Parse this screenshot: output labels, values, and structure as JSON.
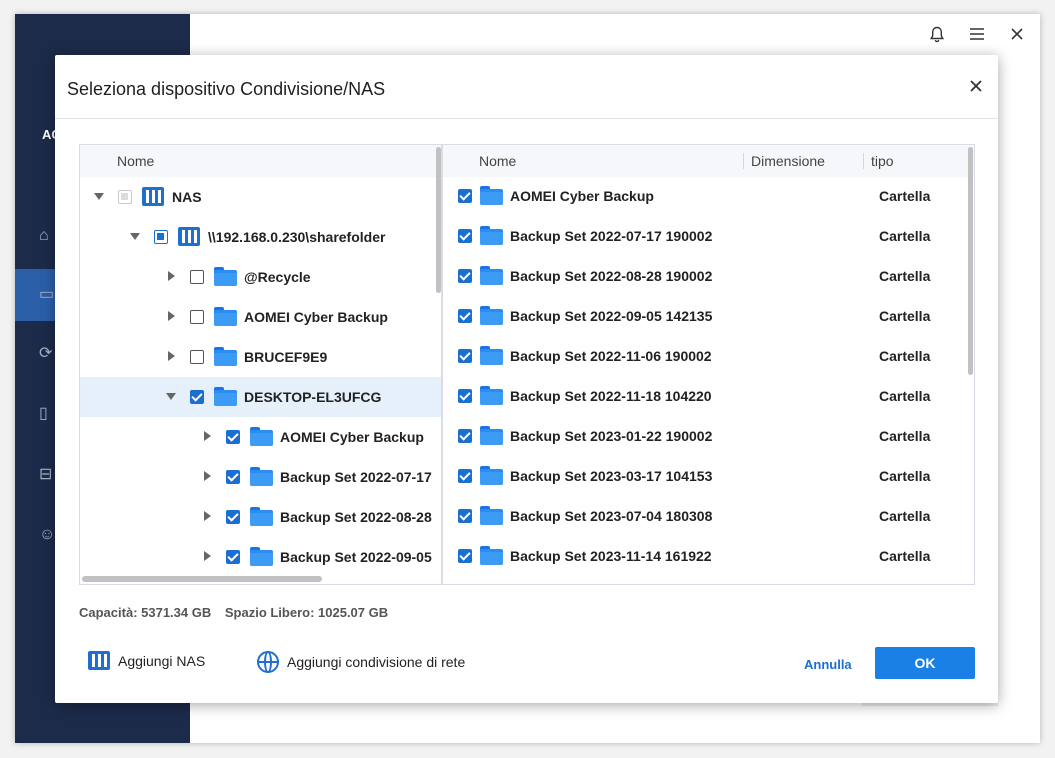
{
  "app": {
    "logo_text": "AO",
    "controls": [
      "bell-icon",
      "menu-icon",
      "close-icon"
    ],
    "sidebar_icons": [
      "home-icon",
      "backup-icon",
      "sync-icon",
      "restore-icon",
      "tools-icon",
      "user-icon"
    ]
  },
  "dialog": {
    "title": "Seleziona dispositivo Condivisione/NAS",
    "left_panel": {
      "header": "Nome",
      "tree": [
        {
          "label": "NAS",
          "level": 0,
          "expanded": true,
          "check": "disabled",
          "icon": "nas-icon",
          "selected": false
        },
        {
          "label": "\\\\192.168.0.230\\sharefolder",
          "level": 1,
          "expanded": true,
          "check": "partial",
          "icon": "nas-icon",
          "selected": false
        },
        {
          "label": "@Recycle",
          "level": 2,
          "expanded": false,
          "check": "unchecked",
          "icon": "folder-icon",
          "selected": false
        },
        {
          "label": "AOMEI Cyber Backup",
          "level": 2,
          "expanded": false,
          "check": "unchecked",
          "icon": "folder-icon",
          "selected": false
        },
        {
          "label": "BRUCEF9E9",
          "level": 2,
          "expanded": false,
          "check": "unchecked",
          "icon": "folder-icon",
          "selected": false
        },
        {
          "label": "DESKTOP-EL3UFCG",
          "level": 2,
          "expanded": true,
          "check": "checked",
          "icon": "folder-icon",
          "selected": true
        },
        {
          "label": "AOMEI Cyber Backup",
          "level": 3,
          "expanded": false,
          "check": "checked",
          "icon": "folder-icon",
          "selected": false
        },
        {
          "label": "Backup Set 2022-07-17",
          "level": 3,
          "expanded": false,
          "check": "checked",
          "icon": "folder-icon",
          "selected": false
        },
        {
          "label": "Backup Set 2022-08-28",
          "level": 3,
          "expanded": false,
          "check": "checked",
          "icon": "folder-icon",
          "selected": false
        },
        {
          "label": "Backup Set 2022-09-05",
          "level": 3,
          "expanded": false,
          "check": "checked",
          "icon": "folder-icon",
          "selected": false
        }
      ]
    },
    "right_panel": {
      "headers": {
        "name": "Nome",
        "size": "Dimensione",
        "type": "tipo"
      },
      "rows": [
        {
          "name": "AOMEI Cyber Backup",
          "size": "",
          "type": "Cartella"
        },
        {
          "name": "Backup Set 2022-07-17 190002",
          "size": "",
          "type": "Cartella"
        },
        {
          "name": "Backup Set 2022-08-28 190002",
          "size": "",
          "type": "Cartella"
        },
        {
          "name": "Backup Set 2022-09-05 142135",
          "size": "",
          "type": "Cartella"
        },
        {
          "name": "Backup Set 2022-11-06 190002",
          "size": "",
          "type": "Cartella"
        },
        {
          "name": "Backup Set 2022-11-18 104220",
          "size": "",
          "type": "Cartella"
        },
        {
          "name": "Backup Set 2023-01-22 190002",
          "size": "",
          "type": "Cartella"
        },
        {
          "name": "Backup Set 2023-03-17 104153",
          "size": "",
          "type": "Cartella"
        },
        {
          "name": "Backup Set 2023-07-04 180308",
          "size": "",
          "type": "Cartella"
        },
        {
          "name": "Backup Set 2023-11-14 161922",
          "size": "",
          "type": "Cartella"
        }
      ]
    },
    "capacity": {
      "capacity_text": "Capacità: 5371.34 GB",
      "free_text": "Spazio Libero: 1025.07 GB"
    },
    "footer": {
      "add_nas": "Aggiungi NAS",
      "add_share": "Aggiungi condivisione di rete",
      "cancel": "Annulla",
      "ok": "OK"
    }
  }
}
